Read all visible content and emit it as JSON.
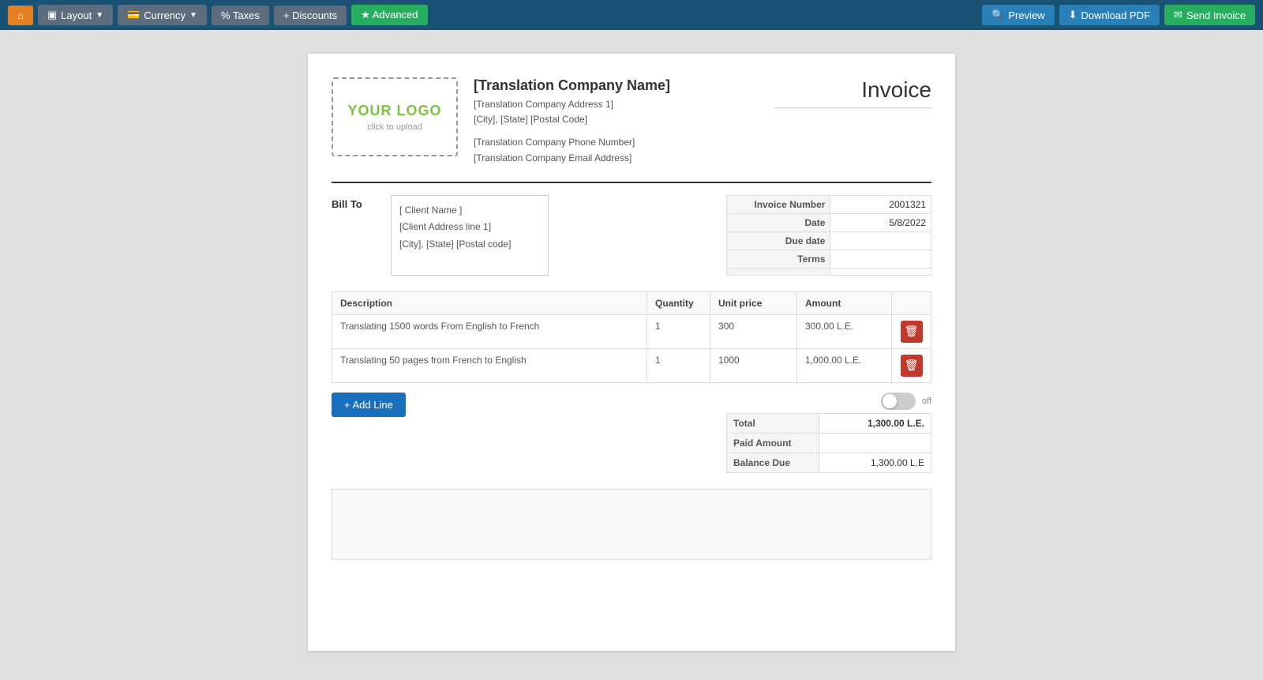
{
  "toolbar": {
    "home_icon": "⌂",
    "layout_label": "Layout",
    "currency_label": "Currency",
    "taxes_label": "% Taxes",
    "discounts_label": "+ Discounts",
    "advanced_label": "★ Advanced",
    "preview_label": "Preview",
    "download_label": "Download PDF",
    "send_label": "Send Invoice"
  },
  "logo": {
    "text": "YOUR LOGO",
    "subtext": "click to upload"
  },
  "company": {
    "name": "[Translation Company Name]",
    "address1": "[Translation Company Address 1]",
    "address2": "[City], [State] [Postal Code]",
    "phone": "[Translation Company Phone Number]",
    "email": "[Translation Company Email Address]"
  },
  "invoice_title": "Invoice",
  "bill_to": {
    "label": "Bill To",
    "client_name": "[ Client Name ]",
    "address1": "[Client Address line 1]",
    "address2": "[City], [State] [Postal code]"
  },
  "invoice_details": {
    "number_label": "Invoice Number",
    "number_value": "2001321",
    "date_label": "Date",
    "date_value": "5/8/2022",
    "due_date_label": "Due date",
    "due_date_value": "",
    "terms_label": "Terms",
    "terms_value": "",
    "extra1_label": "",
    "extra1_value": "",
    "extra2_label": "",
    "extra2_value": ""
  },
  "table": {
    "col_description": "Description",
    "col_quantity": "Quantity",
    "col_unit_price": "Unit price",
    "col_amount": "Amount",
    "rows": [
      {
        "description": "Translating 1500 words From English to French",
        "quantity": "1",
        "unit_price": "300",
        "amount": "300.00 L.E."
      },
      {
        "description": "Translating 50 pages from French to English",
        "quantity": "1",
        "unit_price": "1000",
        "amount": "1,000.00 L.E."
      }
    ]
  },
  "add_line_label": "+ Add Line",
  "toggle_label": "off",
  "totals": {
    "total_label": "Total",
    "total_value": "1,300.00 L.E.",
    "paid_label": "Paid Amount",
    "paid_value": "",
    "balance_label": "Balance Due",
    "balance_value": "1,300.00 L.E"
  }
}
